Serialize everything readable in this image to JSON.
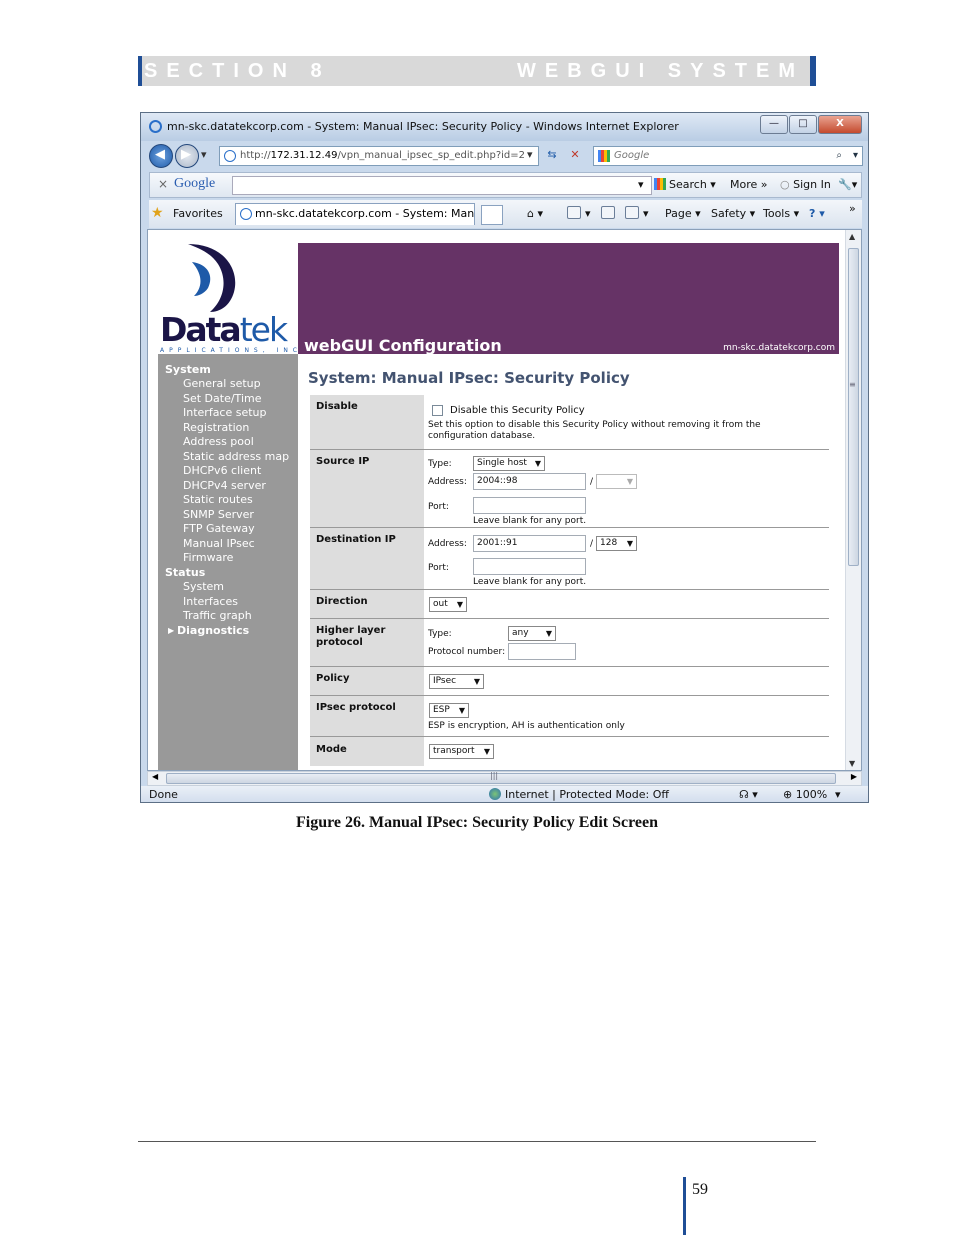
{
  "doc": {
    "section": "SECTION 8",
    "system": "WEBGUI SYSTEM",
    "caption": "Figure 26. Manual IPsec: Security Policy Edit Screen",
    "page_number": "59"
  },
  "browser": {
    "title": "mn-skc.datatekcorp.com - System: Manual IPsec: Security Policy - Windows Internet Explorer",
    "window_buttons": {
      "minimize": "—",
      "maximize": "□",
      "close": "X"
    },
    "address": {
      "prefix": "http://",
      "host": "172.31.12.49",
      "path": "/vpn_manual_ipsec_sp_edit.php?id=2"
    },
    "search_placeholder": "Google",
    "google_toolbar": {
      "close": "×",
      "logo": "Google",
      "search": "Search",
      "more": "More »",
      "sign_in": "Sign In"
    },
    "favorites_label": "Favorites",
    "tab_title": "mn-skc.datatekcorp.com - System: Manual...",
    "commands": {
      "page": "Page",
      "safety": "Safety",
      "tools": "Tools",
      "help": "?"
    },
    "status": {
      "left": "Done",
      "zone": "Internet | Protected Mode: Off",
      "zoom": "100%"
    }
  },
  "webgui": {
    "logo_main": "Data",
    "logo_tek": "tek",
    "logo_sub": "APPLICATIONS, INC",
    "banner_title": "webGUI Configuration",
    "banner_host": "mn-skc.datatekcorp.com",
    "page_title": "System: Manual IPsec: Security Policy",
    "sidebar": {
      "system_header": "System",
      "system_items": [
        "General setup",
        "Set Date/Time",
        "Interface setup",
        "Registration",
        "Address pool",
        "Static address map",
        "DHCPv6 client",
        "DHCPv4 server",
        "Static routes",
        "SNMP Server",
        "FTP Gateway",
        "Manual IPsec",
        "Firmware"
      ],
      "status_header": "Status",
      "status_items": [
        "System",
        "Interfaces",
        "Traffic graph"
      ],
      "diagnostics": "Diagnostics"
    },
    "form": {
      "disable": {
        "label": "Disable",
        "checkbox_label": "Disable this Security Policy",
        "help": "Set this option to disable this Security Policy without removing it from the configuration database.",
        "checked": false
      },
      "source_ip": {
        "label": "Source IP",
        "type_label": "Type:",
        "type_value": "Single host",
        "address_label": "Address:",
        "address_value": "2004::98",
        "slash": "/",
        "mask_value": "",
        "port_label": "Port:",
        "port_value": "",
        "port_help": "Leave blank for any port."
      },
      "destination_ip": {
        "label": "Destination IP",
        "address_label": "Address:",
        "address_value": "2001::91",
        "slash": "/",
        "mask_value": "128",
        "port_label": "Port:",
        "port_value": "",
        "port_help": "Leave blank for any port."
      },
      "direction": {
        "label": "Direction",
        "value": "out"
      },
      "higher_layer": {
        "label": "Higher layer protocol",
        "type_label": "Type:",
        "type_value": "any",
        "number_label": "Protocol number:",
        "number_value": ""
      },
      "policy": {
        "label": "Policy",
        "value": "IPsec"
      },
      "ipsec_protocol": {
        "label": "IPsec protocol",
        "value": "ESP",
        "help": "ESP is encryption, AH is authentication only"
      },
      "mode": {
        "label": "Mode",
        "value": "transport"
      }
    }
  }
}
